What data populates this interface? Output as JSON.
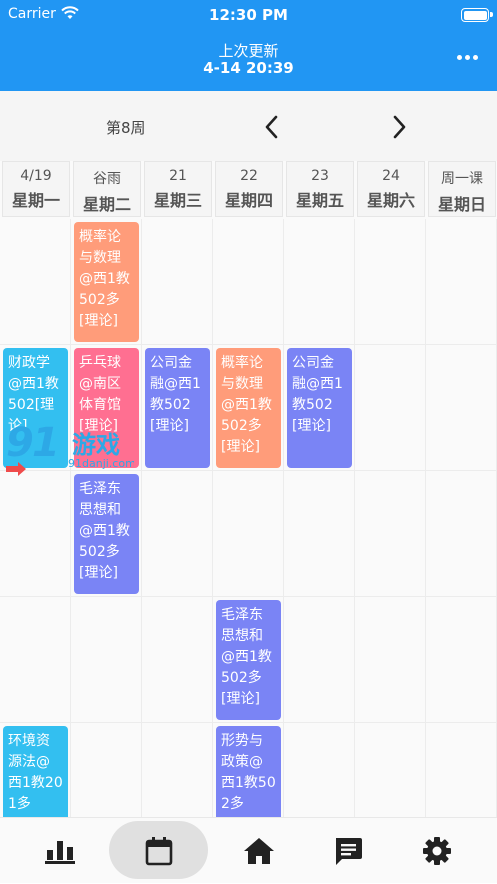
{
  "status": {
    "carrier": "Carrier",
    "time": "12:30 PM"
  },
  "header": {
    "title": "上次更新",
    "subtitle": "4-14 20:39"
  },
  "week": {
    "label": "第8周"
  },
  "days": [
    {
      "date": "4/19",
      "name": "星期一"
    },
    {
      "date": "谷雨",
      "name": "星期二"
    },
    {
      "date": "21",
      "name": "星期三"
    },
    {
      "date": "22",
      "name": "星期四"
    },
    {
      "date": "23",
      "name": "星期五"
    },
    {
      "date": "24",
      "name": "星期六"
    },
    {
      "date": "周一课",
      "name": "星期日"
    }
  ],
  "courses": [
    {
      "text": "概率论与数理@西1教502多[理论]",
      "day": 1,
      "slot": 0,
      "color": "#ff9c7a"
    },
    {
      "text": "财政学@西1教502[理论]",
      "day": 0,
      "slot": 1,
      "color": "#33bff0"
    },
    {
      "text": "乒乓球@南区体育馆[理论]",
      "day": 1,
      "slot": 1,
      "color": "#ff6f91"
    },
    {
      "text": "公司金融@西1教502[理论]",
      "day": 2,
      "slot": 1,
      "color": "#7a84f5"
    },
    {
      "text": "概率论与数理@西1教502多[理论]",
      "day": 3,
      "slot": 1,
      "color": "#ff9c7a"
    },
    {
      "text": "公司金融@西1教502[理论]",
      "day": 4,
      "slot": 1,
      "color": "#7a84f5"
    },
    {
      "text": "毛泽东思想和@西1教502多[理论]",
      "day": 1,
      "slot": 2,
      "color": "#7a84f5"
    },
    {
      "text": "毛泽东思想和@西1教502多[理论]",
      "day": 3,
      "slot": 3,
      "color": "#7a84f5"
    },
    {
      "text": "环境资源法@西1教201多",
      "day": 0,
      "slot": 4,
      "color": "#33bff0"
    },
    {
      "text": "形势与政策@西1教502多",
      "day": 3,
      "slot": 4,
      "color": "#7a84f5"
    }
  ],
  "watermark": {
    "text": "91游戏",
    "sub": "91danji.com"
  },
  "colors": {
    "primary": "#2196f3",
    "orange": "#ff9c7a",
    "blue": "#33bff0",
    "pink": "#ff6f91",
    "purple": "#7a84f5"
  },
  "tabs": [
    {
      "icon": "bar-chart-icon"
    },
    {
      "icon": "calendar-icon",
      "active": true
    },
    {
      "icon": "home-icon"
    },
    {
      "icon": "message-icon"
    },
    {
      "icon": "gear-icon"
    }
  ]
}
